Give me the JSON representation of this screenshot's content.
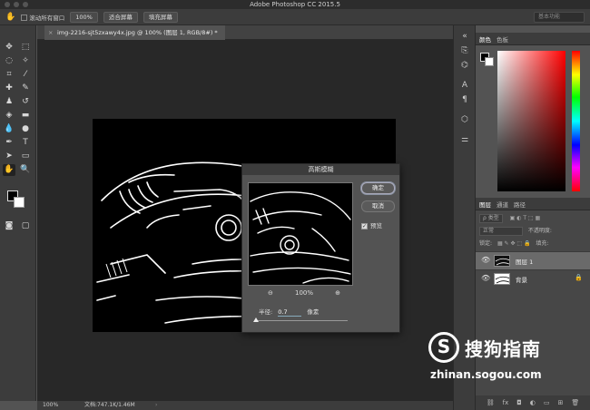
{
  "app": {
    "title": "Adobe Photoshop CC 2015.5"
  },
  "options_bar": {
    "scroll_all_label": "滚动所有窗口",
    "zoom_value": "100%",
    "fit_screen_label": "适合屏幕",
    "fill_screen_label": "填充屏幕",
    "workspace_label": "基本功能"
  },
  "document": {
    "tab_title": "img-2216-sjt5zxawy4x.jpg @ 100% (图层 1, RGB/8#) *",
    "close_glyph": "×"
  },
  "status_bar": {
    "zoom": "100%",
    "doc_size": "文档:747.1K/1.46M",
    "arrow": "›"
  },
  "color_panel": {
    "tabs": [
      "颜色",
      "色板"
    ],
    "fg_color": "#000000",
    "bg_color": "#ffffff"
  },
  "layers_panel": {
    "tabs": [
      "图层",
      "通道",
      "路径"
    ],
    "filter_label": "ρ 类型",
    "blend_mode": "正常",
    "opacity_label": "不透明度:",
    "lock_label": "锁定:",
    "fill_label": "填充:",
    "layers": [
      {
        "name": "图层 1",
        "selected": true,
        "eye": "👁"
      },
      {
        "name": "背景",
        "selected": false,
        "eye": "👁",
        "lock": "🔒"
      }
    ],
    "footer_icons": [
      "link-icon",
      "fx-icon",
      "mask-icon",
      "adjustment-icon",
      "folder-icon",
      "new-layer-icon",
      "trash-icon"
    ],
    "footer_glyphs": [
      "⛓",
      "fx",
      "◘",
      "◐",
      "▭",
      "⊞",
      "🗑"
    ]
  },
  "dialog": {
    "title": "高斯模糊",
    "ok_label": "确定",
    "cancel_label": "取消",
    "preview_label": "预览",
    "preview_checked": true,
    "zoom_value": "100%",
    "zoom_out_glyph": "⊖",
    "zoom_in_glyph": "⊕",
    "radius_label": "半径:",
    "radius_value": "0.7",
    "radius_unit": "像素"
  },
  "watermark": {
    "logo": "S",
    "title": "搜狗指南",
    "url": "zhinan.sogou.com"
  }
}
